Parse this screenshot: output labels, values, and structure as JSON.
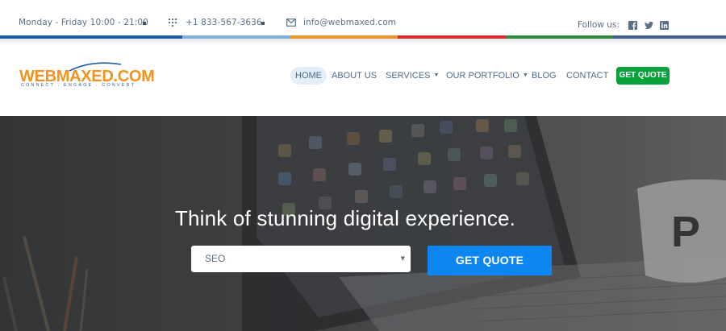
{
  "topbar": {
    "hours": "Monday - Friday 10:00 - 21:00",
    "phone": "+1 833-567-3636",
    "email": "info@webmaxed.com",
    "follow_label": "Follow us:",
    "social_icons": [
      "facebook-icon",
      "twitter-icon",
      "linkedin-icon"
    ]
  },
  "stripe_colors": [
    "#1f5da4",
    "#7fb3dd",
    "#e8942a",
    "#d12e2e",
    "#2e8a3d",
    "#3f5f8a"
  ],
  "logo": {
    "name": "WEBMAXED.COM",
    "tagline": "CONNECT . ENGAGE . CONVERT"
  },
  "nav": {
    "home": "HOME",
    "about": "ABOUT US",
    "services": "SERVICES",
    "portfolio": "OUR PORTFOLIO",
    "blog": "BLOG",
    "contact": "CONTACT",
    "quote": "GET QUOTE"
  },
  "hero": {
    "title": "Think of stunning digital experience.",
    "select_value": "SEO",
    "button": "GET QUOTE"
  },
  "colors": {
    "accent_blue": "#0d86f2",
    "quote_green": "#07a33a",
    "logo_orange": "#f6921e"
  }
}
